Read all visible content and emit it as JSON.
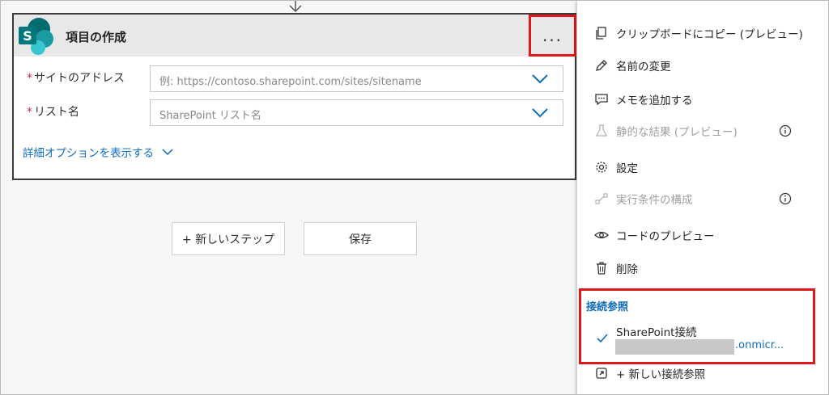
{
  "card": {
    "title": "項目の作成",
    "more_label": "...",
    "fields": [
      {
        "label": "サイトのアドレス",
        "required_mark": "*",
        "placeholder": "例: https://contoso.sharepoint.com/sites/sitename"
      },
      {
        "label": "リスト名",
        "required_mark": "*",
        "placeholder": "SharePoint リスト名"
      }
    ],
    "advanced_link": "詳細オプションを表示する"
  },
  "buttons": {
    "new_step": "+ 新しいステップ",
    "save": "保存"
  },
  "menu": {
    "items": [
      {
        "label": "クリップボードにコピー (プレビュー)",
        "icon": "copy-icon",
        "enabled": true
      },
      {
        "label": "名前の変更",
        "icon": "pencil-icon",
        "enabled": true
      },
      {
        "label": "メモを追加する",
        "icon": "comment-icon",
        "enabled": true
      },
      {
        "label": "静的な結果 (プレビュー)",
        "icon": "flask-icon",
        "enabled": false,
        "info": true
      },
      {
        "label": "設定",
        "icon": "gear-icon",
        "enabled": true
      },
      {
        "label": "実行条件の構成",
        "icon": "flow-icon",
        "enabled": false,
        "info": true
      },
      {
        "label": "コードのプレビュー",
        "icon": "eye-icon",
        "enabled": true
      },
      {
        "label": "削除",
        "icon": "trash-icon",
        "enabled": true
      }
    ],
    "connections": {
      "title": "接続参照",
      "name": "SharePoint接続",
      "domain": ".onmicr..."
    },
    "new_connection": "+ 新しい接続参照"
  },
  "colors": {
    "accent": "#0f6cbd",
    "highlight": "#e0171b",
    "sharepoint": "#038387"
  }
}
